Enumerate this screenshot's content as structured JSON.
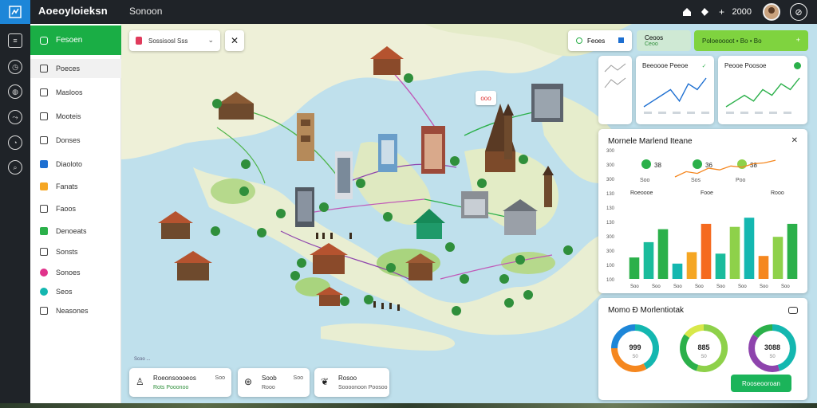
{
  "topbar": {
    "app_title": "Aoeoyloieksn",
    "section_title": "Sonoon",
    "year": "2000",
    "icons": [
      "home-icon",
      "tag-icon",
      "plus-icon",
      "avatar",
      "compass-icon"
    ]
  },
  "rail": {
    "icons": [
      "layers-icon",
      "clock-icon",
      "globe-icon",
      "route-icon",
      "chart-icon",
      "search-icon"
    ]
  },
  "sidebar": {
    "active_label": "Fesoen",
    "items": [
      {
        "label": "Poeces",
        "icon": "square-icon",
        "color": "#444444"
      },
      {
        "label": "Masloos",
        "icon": "list-icon",
        "color": "#444444"
      },
      {
        "label": "Mooteis",
        "icon": "grid-icon",
        "color": "#444444"
      },
      {
        "label": "Donses",
        "icon": "box-icon",
        "color": "#444444"
      },
      {
        "label": "Diaoloto",
        "icon": "blue-square-icon",
        "color": "#1d6fd1"
      },
      {
        "label": "Fanats",
        "icon": "orange-square-icon",
        "color": "#f5a623"
      },
      {
        "label": "Faoos",
        "icon": "doc-icon",
        "color": "#444444"
      },
      {
        "label": "Denoeats",
        "icon": "green-square-icon",
        "color": "#2bb04a"
      },
      {
        "label": "Sonsts",
        "icon": "share-icon",
        "color": "#444444"
      },
      {
        "label": "Sonoes",
        "icon": "pink-dot-icon",
        "color": "#e0338b"
      },
      {
        "label": "Seos",
        "icon": "teal-dot-icon",
        "color": "#14b7b0"
      },
      {
        "label": "Neasones",
        "icon": "swap-icon",
        "color": "#444444"
      }
    ]
  },
  "map": {
    "search_value": "Sossisosl Sss",
    "tag_text": "ooo",
    "scale_text": "Scoo ...",
    "bottom_cards": [
      {
        "title": "Roeonsoooeos",
        "sub": "Rots Pooonoo",
        "right": "Soo",
        "icon": "person-icon"
      },
      {
        "title": "Soob",
        "sub": "Rooo",
        "right": "Soo",
        "icon": "compass-icon"
      },
      {
        "title": "Rosoo",
        "sub": "Soooonoon Poosoo",
        "right": "",
        "icon": "leaf-icon"
      }
    ]
  },
  "filters": {
    "chip1": "Feoes",
    "chip2": "Ceoos",
    "chip2_sub": "Ceoo",
    "chip3": "Poloeoooot • Bo • Bo"
  },
  "stats": {
    "card1_title": "Beeoooe Peeoe",
    "card2_title": "Peooe Poosoe"
  },
  "bar_panel": {
    "title": "Mornele Marlend Iteane",
    "kpis": [
      {
        "value": "38",
        "label": "Soo"
      },
      {
        "value": "36",
        "label": "Sos"
      },
      {
        "value": "38",
        "label": "Poo"
      }
    ],
    "legend": [
      "Roeoooe",
      "Fooe",
      "Rooo"
    ]
  },
  "donut_panel": {
    "title": "Momo Ð Morlentiotak",
    "button": "Rooseooroan",
    "donuts": [
      {
        "value": "999",
        "sub": "S0",
        "colors": [
          "#14b7b0",
          "#f5871f",
          "#1d86d8"
        ],
        "fractions": [
          0.42,
          0.33,
          0.25
        ]
      },
      {
        "value": "885",
        "sub": "S0",
        "colors": [
          "#8ed14a",
          "#2bb04a",
          "#d8e84a"
        ],
        "fractions": [
          0.55,
          0.3,
          0.15
        ]
      },
      {
        "value": "3088",
        "sub": "S0",
        "colors": [
          "#14b7b0",
          "#8e44ad",
          "#2bb04a"
        ],
        "fractions": [
          0.45,
          0.4,
          0.15
        ]
      }
    ]
  },
  "chart_data": [
    {
      "type": "line",
      "title": "Beeoooe Peeoe",
      "series": [
        {
          "values": [
            3,
            4,
            5,
            6,
            4,
            7,
            6,
            8
          ]
        }
      ]
    },
    {
      "type": "line",
      "title": "Peooe Poosoe",
      "series": [
        {
          "values": [
            2,
            3,
            4,
            3,
            5,
            4,
            6,
            5,
            7
          ]
        }
      ]
    },
    {
      "type": "bar",
      "title": "Mornele Marlend Iteane",
      "categories": [
        "Soo",
        "Soo",
        "Soo",
        "Soo",
        "Soo",
        "Soo",
        "Soo",
        "Soo"
      ],
      "yticks": [
        "300",
        "300",
        "300",
        "130",
        "130",
        "130",
        "300",
        "300",
        "100",
        "100"
      ],
      "ylim": [
        0,
        100
      ],
      "bars": [
        {
          "value": 28,
          "color": "#2bb04a"
        },
        {
          "value": 48,
          "color": "#1abc9c"
        },
        {
          "value": 65,
          "color": "#2bb04a"
        },
        {
          "value": 20,
          "color": "#14b7b0"
        },
        {
          "value": 35,
          "color": "#f5a623"
        },
        {
          "value": 72,
          "color": "#f56a1f"
        },
        {
          "value": 33,
          "color": "#1abc9c"
        },
        {
          "value": 68,
          "color": "#8ed14a"
        },
        {
          "value": 80,
          "color": "#14b7b0"
        },
        {
          "value": 30,
          "color": "#f5871f"
        },
        {
          "value": 55,
          "color": "#8ed14a"
        },
        {
          "value": 72,
          "color": "#2bb04a"
        }
      ],
      "line": [
        40,
        52,
        48,
        60,
        56,
        65,
        62,
        70,
        72,
        78
      ]
    }
  ]
}
